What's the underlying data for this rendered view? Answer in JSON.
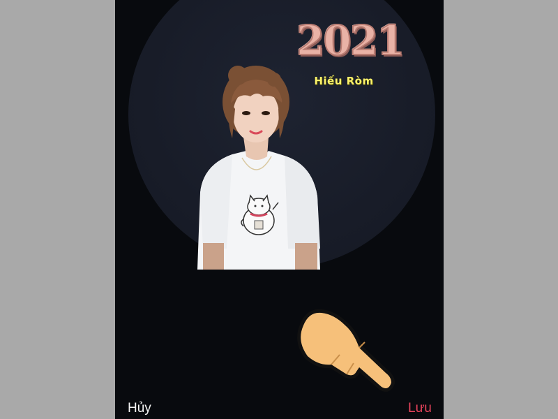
{
  "overlay": {
    "year": "2021",
    "name": "Hiếu Ròm"
  },
  "actions": {
    "cancel_label": "Hủy",
    "save_label": "Lưu"
  },
  "colors": {
    "background": "#080a0e",
    "preview_circle": "#181c28",
    "cancel_text": "#f3f3f3",
    "save_text": "#e8435c",
    "balloon": "#e9b2a6",
    "name_text": "#fdf36b"
  },
  "icons": [
    "pointing-hand-icon"
  ]
}
